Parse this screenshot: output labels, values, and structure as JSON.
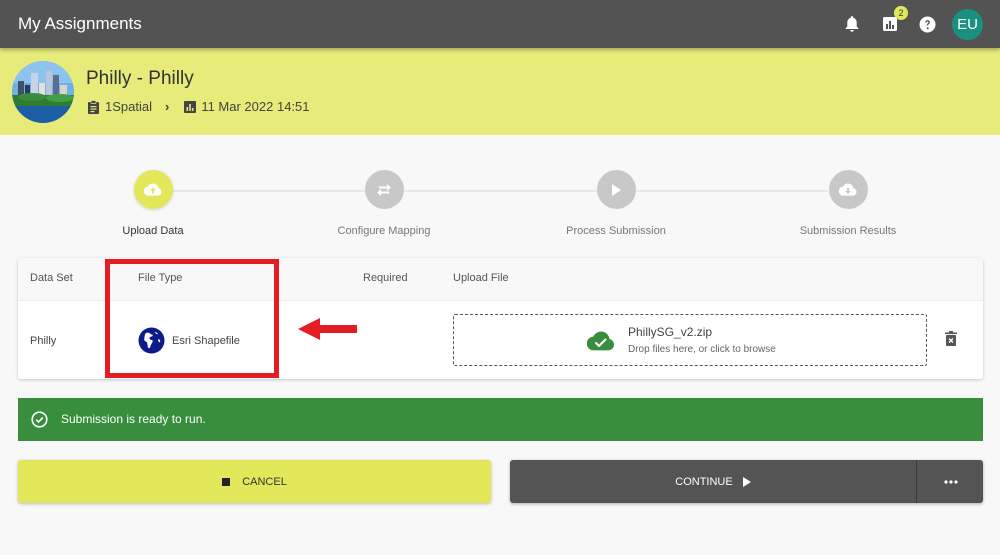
{
  "appbar": {
    "title": "My Assignments",
    "notifications_badge": "2",
    "user_initials": "EU",
    "icons": [
      "bell-icon",
      "chart-icon",
      "help-icon"
    ]
  },
  "assignment": {
    "title": "Philly - Philly",
    "organization": "1Spatial",
    "date": "11 Mar 2022 14:51"
  },
  "stepper": {
    "steps": [
      {
        "label": "Upload Data",
        "icon": "cloud-upload-icon",
        "state": "active"
      },
      {
        "label": "Configure Mapping",
        "icon": "swap-icon",
        "state": "inactive"
      },
      {
        "label": "Process Submission",
        "icon": "play-icon",
        "state": "inactive"
      },
      {
        "label": "Submission Results",
        "icon": "cloud-download-icon",
        "state": "inactive"
      }
    ]
  },
  "table": {
    "headers": {
      "data_set": "Data Set",
      "file_type": "File Type",
      "required": "Required",
      "upload_file": "Upload File"
    },
    "rows": [
      {
        "data_set": "Philly",
        "file_type": "Esri Shapefile",
        "required": "",
        "uploaded_file": "PhillySG_v2.zip",
        "dropzone_hint": "Drop files here, or click to browse"
      }
    ]
  },
  "alert": {
    "message": "Submission is ready to run.",
    "color": "#388e3c"
  },
  "actions": {
    "cancel_label": "CANCEL",
    "continue_label": "CONTINUE",
    "more_label": "more options"
  },
  "colors": {
    "accent": "#e2e85a",
    "appbar": "#535353",
    "header_band": "#e6eb7a",
    "avatar": "#1a9180",
    "annotation": "#e41c23"
  }
}
